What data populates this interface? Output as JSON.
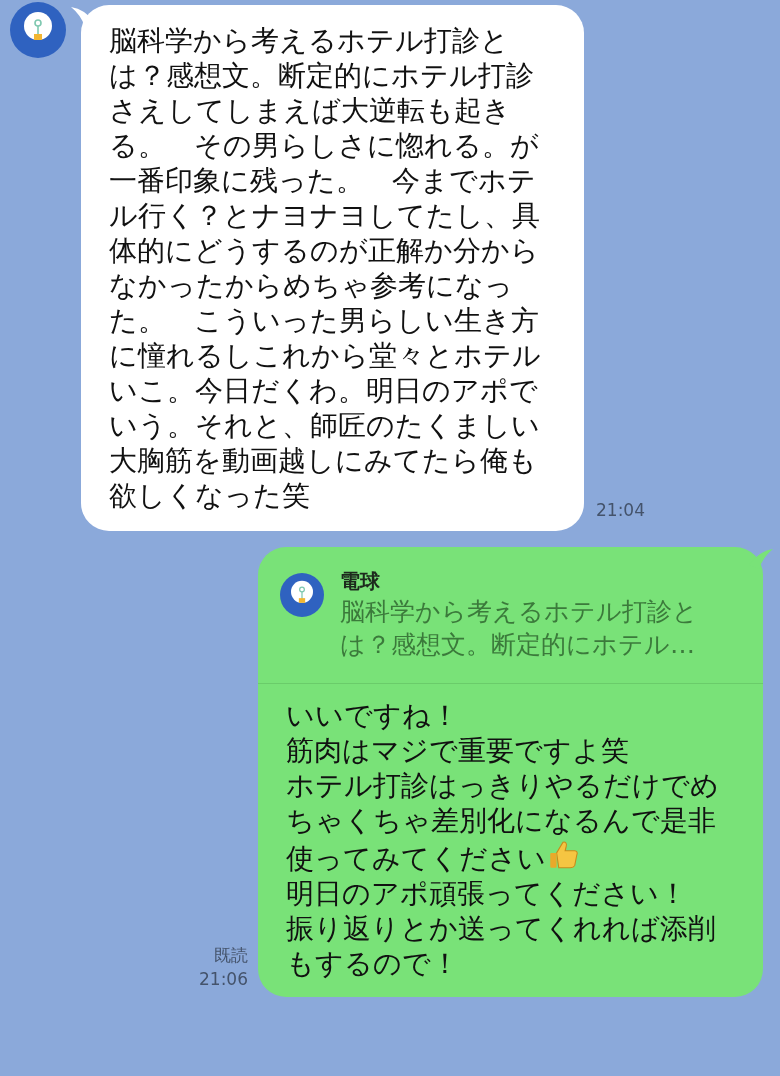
{
  "incoming": {
    "text": "脳科学から考えるホテル打診とは？感想文。断定的にホテル打診さえしてしまえば大逆転も起きる。　その男らしさに惚れる。が一番印象に残った。　今までホテル行く？とナヨナヨしてたし、具体的にどうするのが正解か分からなかったからめちゃ参考になった。　こういった男らしい生き方に憧れるしこれから堂々とホテルいこ。今日だくわ。明日のアポでいう。それと、師匠のたくましい大胸筋を動画越しにみてたら俺も欲しくなった笑",
    "time": "21:04"
  },
  "outgoing": {
    "quote": {
      "name": "電球",
      "text": "脳科学から考えるホテル打診とは？感想文。断定的にホテル…"
    },
    "lines": [
      {
        "text": "いいですね！",
        "emoji": false
      },
      {
        "text": "筋肉はマジで重要ですよ笑",
        "emoji": false
      },
      {
        "text": "ホテル打診はっきりやるだけでめちゃくちゃ差別化になるんで是非使ってみてください",
        "emoji": true
      },
      {
        "text": "明日のアポ頑張ってください！",
        "emoji": false
      },
      {
        "text": "振り返りとか送ってくれれば添削もするので！",
        "emoji": false
      }
    ],
    "read": "既読",
    "time": "21:06"
  }
}
